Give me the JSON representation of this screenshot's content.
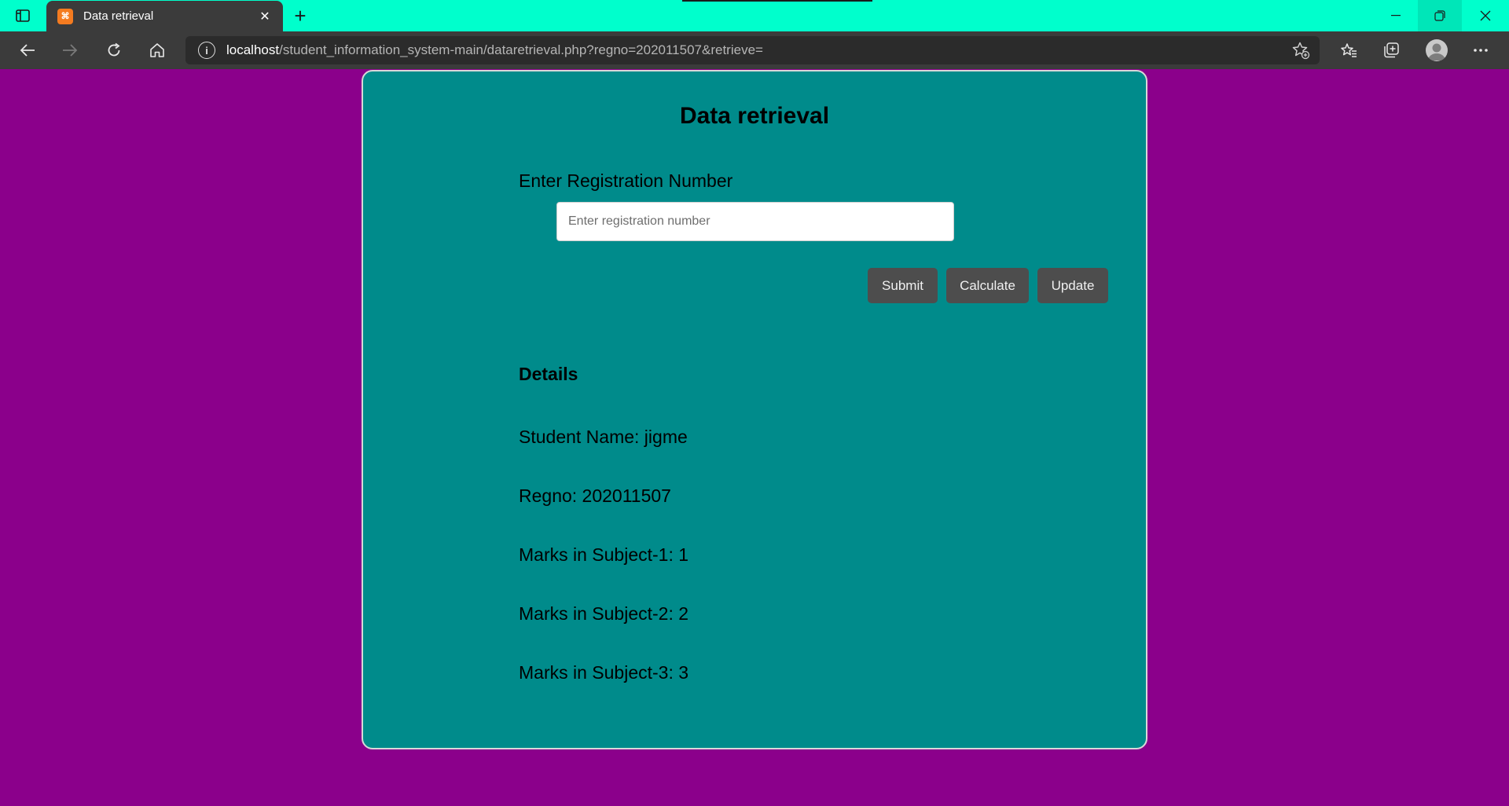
{
  "browser": {
    "tab_title": "Data retrieval",
    "tab_favicon_text": "⌘",
    "url_host": "localhost",
    "url_path": "/student_information_system-main/dataretrieval.php?regno=202011507&retrieve=",
    "icons": {
      "tab_actions": "tab-actions-icon",
      "new_tab": "plus-icon",
      "close_tab": "close-icon",
      "back": "back-arrow-icon",
      "forward": "forward-arrow-icon",
      "refresh": "refresh-icon",
      "home": "home-icon",
      "site_info": "info-icon",
      "add_favorite": "star-plus-icon",
      "favorites": "favorites-icon",
      "collections": "collections-icon",
      "profile": "profile-avatar",
      "more": "more-icon",
      "minimize": "minimize-icon",
      "restore": "restore-icon",
      "close_window": "close-window-icon"
    }
  },
  "page": {
    "title": "Data retrieval",
    "reg_label": "Enter Registration Number",
    "reg_placeholder": "Enter registration number",
    "buttons": {
      "submit": "Submit",
      "calculate": "Calculate",
      "update": "Update"
    },
    "details_heading": "Details",
    "details": [
      "Student Name: jigme",
      "Regno: 202011507",
      "Marks in Subject-1: 1",
      "Marks in Subject-2: 2",
      "Marks in Subject-3: 3"
    ]
  },
  "colors": {
    "page_background": "#8b008b",
    "card_background": "#008b8b",
    "tabbar_background": "#00ffcc",
    "button_background": "#4d4d4d"
  }
}
